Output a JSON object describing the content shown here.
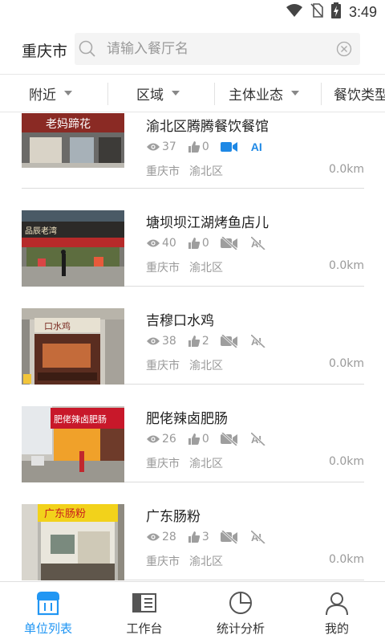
{
  "status_bar": {
    "time": "3:49",
    "icons": [
      "wifi-icon",
      "no-sim-icon",
      "battery-charging-icon"
    ]
  },
  "search": {
    "city": "重庆市",
    "placeholder": "请输入餐厅名",
    "value": ""
  },
  "filters": [
    {
      "label": "附近",
      "has_caret": true
    },
    {
      "label": "区域",
      "has_caret": true
    },
    {
      "label": "主体业态",
      "has_caret": true
    },
    {
      "label": "餐饮类型",
      "has_caret": false
    }
  ],
  "restaurants": [
    {
      "name": "渝北区腾腾餐饮餐馆",
      "views": "37",
      "likes": "0",
      "video": true,
      "ai": true,
      "ai_label": "AI",
      "city": "重庆市",
      "district": "渝北区",
      "distance": "0.0km",
      "photo_sign": "老妈蹄花"
    },
    {
      "name": "塘坝坝江湖烤鱼店儿",
      "views": "40",
      "likes": "0",
      "video": false,
      "ai": false,
      "city": "重庆市",
      "district": "渝北区",
      "distance": "0.0km",
      "photo_sign": "品辰老湾"
    },
    {
      "name": "吉穆口水鸡",
      "views": "38",
      "likes": "2",
      "video": false,
      "ai": false,
      "city": "重庆市",
      "district": "渝北区",
      "distance": "0.0km",
      "photo_sign": "口水鸡"
    },
    {
      "name": "肥佬辣卤肥肠",
      "views": "26",
      "likes": "0",
      "video": false,
      "ai": false,
      "city": "重庆市",
      "district": "渝北区",
      "distance": "0.0km",
      "photo_sign": "肥佬辣卤肥肠"
    },
    {
      "name": "广东肠粉",
      "views": "28",
      "likes": "3",
      "video": false,
      "ai": false,
      "city": "重庆市",
      "district": "渝北区",
      "distance": "0.0km",
      "photo_sign": "广东肠粉"
    }
  ],
  "tabs": [
    {
      "label": "单位列表",
      "icon": "store-icon",
      "active": true
    },
    {
      "label": "工作台",
      "icon": "workbench-icon",
      "active": false
    },
    {
      "label": "统计分析",
      "icon": "pie-chart-icon",
      "active": false
    },
    {
      "label": "我的",
      "icon": "user-icon",
      "active": false
    }
  ],
  "colors": {
    "accent": "#2196f3",
    "ai_blue": "#1e88e5",
    "muted": "#999999"
  }
}
